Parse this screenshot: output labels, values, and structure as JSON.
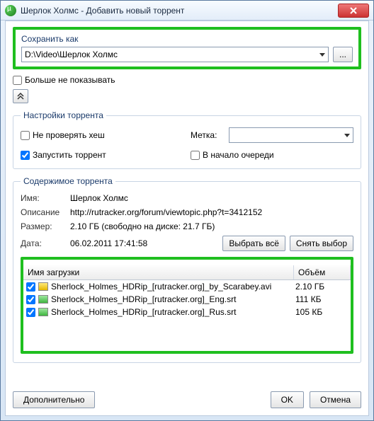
{
  "window": {
    "title": "Шерлок Холмс - Добавить новый торрент"
  },
  "saveAs": {
    "label": "Сохранить как",
    "path": "D:\\Video\\Шерлок Холмс",
    "browse": "..."
  },
  "dontShow": "Больше не показывать",
  "settings": {
    "legend": "Настройки торрента",
    "skipHash": "Не проверять хеш",
    "startTorrent": "Запустить торрент",
    "labelLabel": "Метка:",
    "labelValue": "",
    "queueFirst": "В начало очереди"
  },
  "content": {
    "legend": "Содержимое торрента",
    "nameLabel": "Имя:",
    "nameValue": "Шерлок Холмс",
    "descLabel": "Описание",
    "descValue": "http://rutracker.org/forum/viewtopic.php?t=3412152",
    "sizeLabel": "Размер:",
    "sizeValue": "2.10 ГБ (свободно на диске: 21.7 ГБ)",
    "dateLabel": "Дата:",
    "dateValue": "06.02.2011 17:41:58",
    "selectAll": "Выбрать всё",
    "deselect": "Снять выбор",
    "colName": "Имя загрузки",
    "colSize": "Объём",
    "files": [
      {
        "checked": true,
        "icon": "avi",
        "name": "Sherlock_Holmes_HDRip_[rutracker.org]_by_Scarabey.avi",
        "size": "2.10 ГБ"
      },
      {
        "checked": true,
        "icon": "srt",
        "name": "Sherlock_Holmes_HDRip_[rutracker.org]_Eng.srt",
        "size": "111 КБ"
      },
      {
        "checked": true,
        "icon": "srt",
        "name": "Sherlock_Holmes_HDRip_[rutracker.org]_Rus.srt",
        "size": "105 КБ"
      }
    ]
  },
  "buttons": {
    "advanced": "Дополнительно",
    "ok": "OK",
    "cancel": "Отмена"
  }
}
